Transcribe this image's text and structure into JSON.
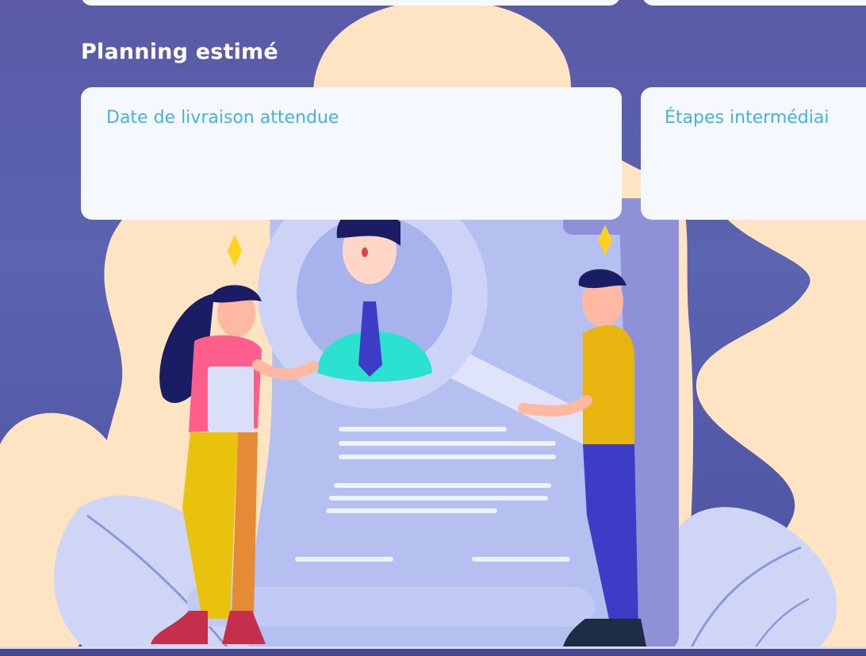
{
  "planning": {
    "title": "Planning estimé",
    "fields": [
      {
        "label": "Date de livraison attendue"
      },
      {
        "label": "Étapes intermédiai"
      }
    ]
  },
  "colors": {
    "background": "#5a5aa6",
    "card": "#f5f8ff",
    "label": "#43b3e0",
    "blob": "#ffe5c4"
  }
}
